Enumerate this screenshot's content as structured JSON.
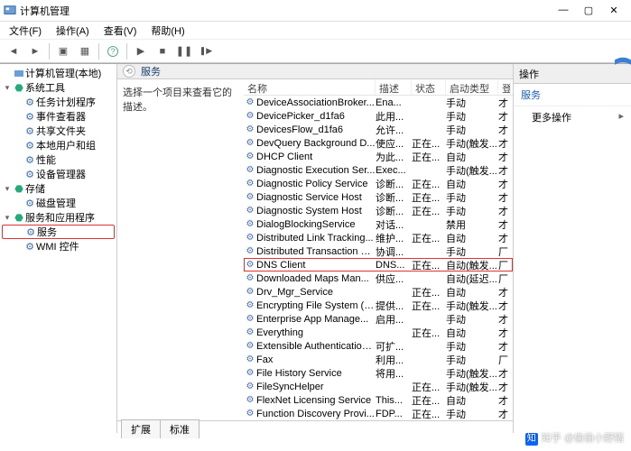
{
  "window": {
    "title": "计算机管理"
  },
  "menubar": [
    "文件(F)",
    "操作(A)",
    "查看(V)",
    "帮助(H)"
  ],
  "tree": {
    "root": "计算机管理(本地)",
    "groups": [
      {
        "label": "系统工具",
        "expanded": true,
        "children": [
          {
            "label": "任务计划程序"
          },
          {
            "label": "事件查看器"
          },
          {
            "label": "共享文件夹"
          },
          {
            "label": "本地用户和组"
          },
          {
            "label": "性能"
          },
          {
            "label": "设备管理器"
          }
        ]
      },
      {
        "label": "存储",
        "expanded": true,
        "children": [
          {
            "label": "磁盘管理"
          }
        ]
      },
      {
        "label": "服务和应用程序",
        "expanded": true,
        "children": [
          {
            "label": "服务",
            "highlight": true
          },
          {
            "label": "WMI 控件"
          }
        ]
      }
    ]
  },
  "mid": {
    "header": "服务",
    "desc": "选择一个项目来查看它的描述。",
    "columns": {
      "name": "名称",
      "desc": "描述",
      "status": "状态",
      "start": "启动类型",
      "logon": "登"
    },
    "tabs": [
      "扩展",
      "标准"
    ],
    "services": [
      {
        "name": "DeviceAssociationBroker...",
        "desc": "Ena...",
        "status": "",
        "start": "手动",
        "logon": "才"
      },
      {
        "name": "DevicePicker_d1fa6",
        "desc": "此用...",
        "status": "",
        "start": "手动",
        "logon": "才"
      },
      {
        "name": "DevicesFlow_d1fa6",
        "desc": "允许...",
        "status": "",
        "start": "手动",
        "logon": "才"
      },
      {
        "name": "DevQuery Background D...",
        "desc": "使应...",
        "status": "正在...",
        "start": "手动(触发...",
        "logon": "才"
      },
      {
        "name": "DHCP Client",
        "desc": "为此...",
        "status": "正在...",
        "start": "自动",
        "logon": "才"
      },
      {
        "name": "Diagnostic Execution Ser...",
        "desc": "Exec...",
        "status": "",
        "start": "手动(触发...",
        "logon": "才"
      },
      {
        "name": "Diagnostic Policy Service",
        "desc": "诊断...",
        "status": "正在...",
        "start": "自动",
        "logon": "才"
      },
      {
        "name": "Diagnostic Service Host",
        "desc": "诊断...",
        "status": "正在...",
        "start": "手动",
        "logon": "才"
      },
      {
        "name": "Diagnostic System Host",
        "desc": "诊断...",
        "status": "正在...",
        "start": "手动",
        "logon": "才"
      },
      {
        "name": "DialogBlockingService",
        "desc": "对话...",
        "status": "",
        "start": "禁用",
        "logon": "才"
      },
      {
        "name": "Distributed Link Tracking...",
        "desc": "维护...",
        "status": "正在...",
        "start": "自动",
        "logon": "才"
      },
      {
        "name": "Distributed Transaction C...",
        "desc": "协调...",
        "status": "",
        "start": "手动",
        "logon": "厂"
      },
      {
        "name": "DNS Client",
        "desc": "DNS...",
        "status": "正在...",
        "start": "自动(触发...",
        "logon": "厂",
        "highlight": true
      },
      {
        "name": "Downloaded Maps Man...",
        "desc": "供应...",
        "status": "",
        "start": "自动(延迟...",
        "logon": "厂"
      },
      {
        "name": "Drv_Mgr_Service",
        "desc": "",
        "status": "正在...",
        "start": "自动",
        "logon": "才"
      },
      {
        "name": "Encrypting File System (E...",
        "desc": "提供...",
        "status": "正在...",
        "start": "手动(触发...",
        "logon": "才"
      },
      {
        "name": "Enterprise App Manage...",
        "desc": "启用...",
        "status": "",
        "start": "手动",
        "logon": "才"
      },
      {
        "name": "Everything",
        "desc": "",
        "status": "正在...",
        "start": "自动",
        "logon": "才"
      },
      {
        "name": "Extensible Authentication...",
        "desc": "可扩...",
        "status": "",
        "start": "手动",
        "logon": "才"
      },
      {
        "name": "Fax",
        "desc": "利用...",
        "status": "",
        "start": "手动",
        "logon": "厂"
      },
      {
        "name": "File History Service",
        "desc": "将用...",
        "status": "",
        "start": "手动(触发...",
        "logon": "才"
      },
      {
        "name": "FileSyncHelper",
        "desc": "",
        "status": "正在...",
        "start": "手动(触发...",
        "logon": "才"
      },
      {
        "name": "FlexNet Licensing Service",
        "desc": "This...",
        "status": "正在...",
        "start": "自动",
        "logon": "才"
      },
      {
        "name": "Function Discovery Provi...",
        "desc": "FDP...",
        "status": "正在...",
        "start": "手动",
        "logon": "才"
      }
    ]
  },
  "actions": {
    "header": "操作",
    "group": "服务",
    "more": "更多操作"
  },
  "watermark": "知乎 @偷偷小野猪"
}
